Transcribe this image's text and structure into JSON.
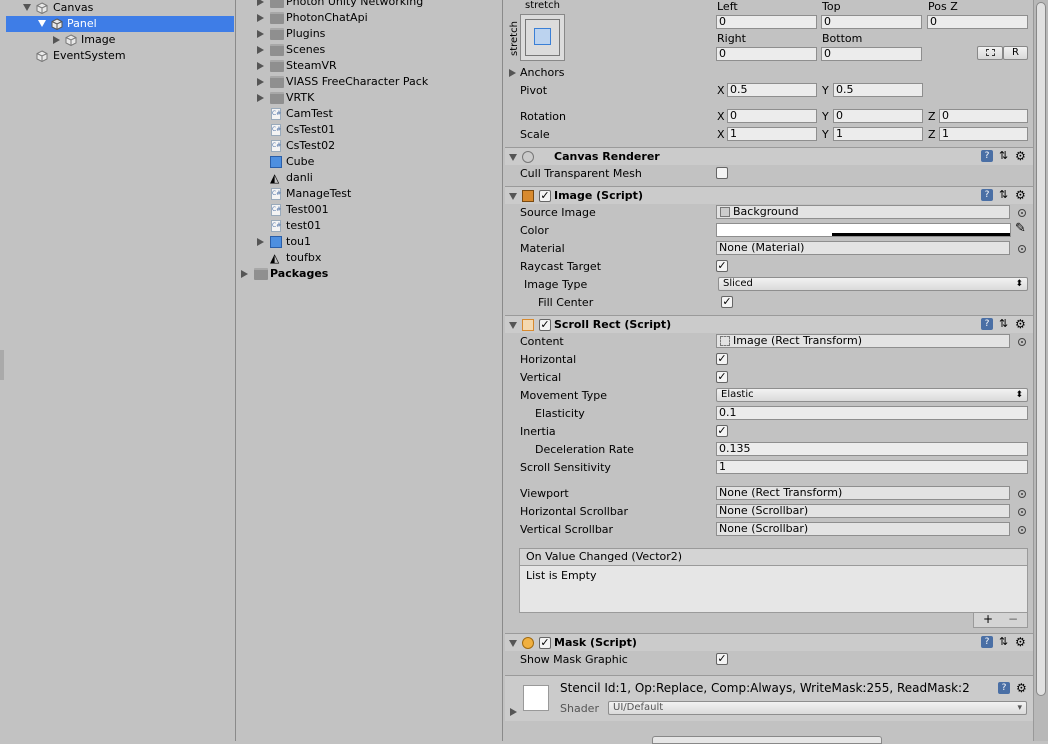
{
  "hierarchy": {
    "items": [
      {
        "label": "Canvas"
      },
      {
        "label": "Panel"
      },
      {
        "label": "Image"
      },
      {
        "label": "EventSystem"
      }
    ]
  },
  "project": {
    "items": [
      {
        "label": "Photon Unity Networking"
      },
      {
        "label": "PhotonChatApi"
      },
      {
        "label": "Plugins"
      },
      {
        "label": "Scenes"
      },
      {
        "label": "SteamVR"
      },
      {
        "label": "VIASS FreeCharacter Pack"
      },
      {
        "label": "VRTK"
      },
      {
        "label": "CamTest"
      },
      {
        "label": "CsTest01"
      },
      {
        "label": "CsTest02"
      },
      {
        "label": "Cube"
      },
      {
        "label": "danli"
      },
      {
        "label": "ManageTest"
      },
      {
        "label": "Test001"
      },
      {
        "label": "test01"
      },
      {
        "label": "tou1"
      },
      {
        "label": "toufbx"
      },
      {
        "label": "Packages"
      }
    ]
  },
  "rect_transform": {
    "anchor_preset_top": "stretch",
    "anchor_preset_side": "stretch",
    "left_label": "Left",
    "left_value": "0",
    "top_label": "Top",
    "top_value": "0",
    "posz_label": "Pos Z",
    "posz_value": "0",
    "right_label": "Right",
    "right_value": "0",
    "bottom_label": "Bottom",
    "bottom_value": "0",
    "r_button": "R",
    "anchors_label": "Anchors",
    "pivot_label": "Pivot",
    "pivot_x": "0.5",
    "pivot_y": "0.5",
    "rotation_label": "Rotation",
    "rot_x": "0",
    "rot_y": "0",
    "rot_z": "0",
    "scale_label": "Scale",
    "scale_x": "1",
    "scale_y": "1",
    "scale_z": "1",
    "x": "X",
    "y": "Y",
    "z": "Z"
  },
  "canvas_renderer": {
    "title": "Canvas Renderer",
    "cull_label": "Cull Transparent Mesh",
    "cull_checked": false
  },
  "image_script": {
    "title": "Image (Script)",
    "source_image_label": "Source Image",
    "source_image_value": "Background",
    "color_label": "Color",
    "material_label": "Material",
    "material_value": "None (Material)",
    "raycast_label": "Raycast Target",
    "image_type_label": "Image Type",
    "image_type_value": "Sliced",
    "fill_center_label": "Fill Center"
  },
  "scroll_rect": {
    "title": "Scroll Rect (Script)",
    "content_label": "Content",
    "content_value": "Image (Rect Transform)",
    "horizontal_label": "Horizontal",
    "vertical_label": "Vertical",
    "movement_label": "Movement Type",
    "movement_value": "Elastic",
    "elasticity_label": "Elasticity",
    "elasticity_value": "0.1",
    "inertia_label": "Inertia",
    "decel_label": "Deceleration Rate",
    "decel_value": "0.135",
    "sensitivity_label": "Scroll Sensitivity",
    "sensitivity_value": "1",
    "viewport_label": "Viewport",
    "viewport_value": "None (Rect Transform)",
    "hscroll_label": "Horizontal Scrollbar",
    "hscroll_value": "None (Scrollbar)",
    "vscroll_label": "Vertical Scrollbar",
    "vscroll_value": "None (Scrollbar)",
    "event_title": "On Value Changed (Vector2)",
    "event_empty": "List is Empty",
    "plus": "+",
    "minus": "−"
  },
  "mask_script": {
    "title": "Mask (Script)",
    "show_graphic_label": "Show Mask Graphic"
  },
  "material_preview": {
    "stencil_text": "Stencil Id:1, Op:Replace, Comp:Always, WriteMask:255, ReadMask:2",
    "shader_label": "Shader",
    "shader_value": "UI/Default"
  },
  "colors": {
    "selection": "#3e7de7",
    "panel_bg": "#c2c2c2",
    "header_bg": "#cbcbcb"
  }
}
